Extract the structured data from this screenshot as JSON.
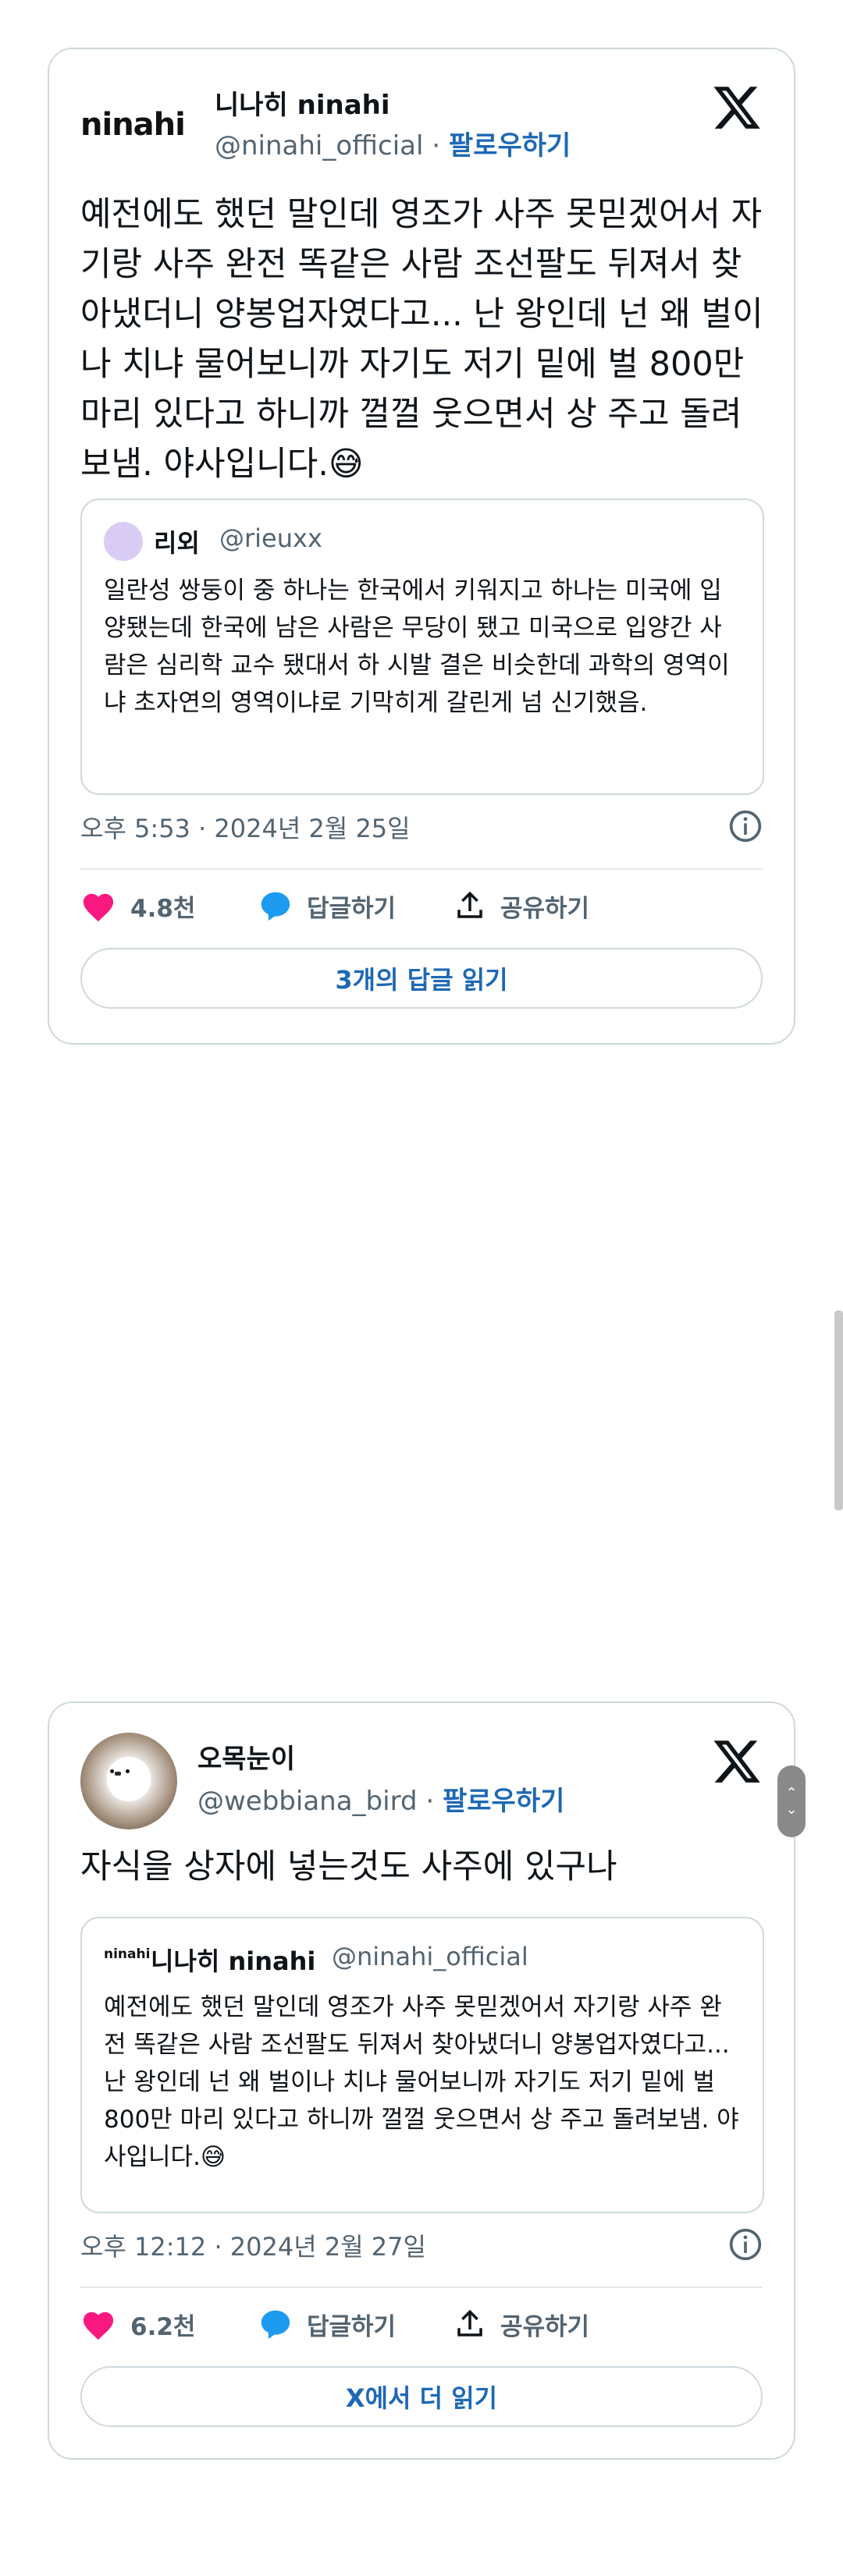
{
  "tweet1": {
    "logo_text": "ninahi",
    "name": "니나히 ninahi",
    "handle": "@ninahi_official",
    "separator": " · ",
    "follow_label": "팔로우하기",
    "text": "예전에도 했던 말인데 영조가 사주 못믿겠어서 자기랑 사주 완전 똑같은 사람 조선팔도 뒤져서 찾아냈더니 양봉업자였다고... 난 왕인데 넌 왜 벌이나 치냐 물어보니까 자기도 저기 밑에 벌 800만 마리 있다고 하니까 껄껄 웃으면서 상 주고 돌려보냄. 야사입니다.😅",
    "quote": {
      "name": "리외",
      "handle": "@rieuxx",
      "text": "일란성 쌍둥이 중 하나는 한국에서 키워지고 하나는 미국에 입양됐는데 한국에 남은 사람은 무당이 됐고 미국으로 입양간 사람은 심리학 교수 됐대서 하 시발 결은 비슷한데 과학의 영역이냐 초자연의 영역이냐로 기막히게 갈린게 넘 신기했음."
    },
    "timestamp": "오후 5:53 · 2024년 2월 25일",
    "likes": "4.8천",
    "reply_label": "답글하기",
    "share_label": "공유하기",
    "read_button": "3개의 답글 읽기"
  },
  "tweet2": {
    "name": "오목눈이",
    "handle": "@webbiana_bird",
    "separator": " · ",
    "follow_label": "팔로우하기",
    "text": "자식을 상자에 넣는것도 사주에 있구나",
    "quote": {
      "logo_text": "ninahi",
      "name": "니나히 ninahi",
      "handle": "@ninahi_official",
      "text": "예전에도 했던 말인데 영조가 사주 못믿겠어서 자기랑 사주 완전 똑같은 사람 조선팔도 뒤져서 찾아냈더니 양봉업자였다고... 난 왕인데 넌 왜 벌이나 치냐 물어보니까 자기도 저기 밑에 벌 800만 마리 있다고 하니까 껄껄 웃으면서 상 주고 돌려보냄. 야사입니다.😅"
    },
    "timestamp": "오후 12:12 · 2024년 2월 27일",
    "likes": "6.2천",
    "reply_label": "답글하기",
    "share_label": "공유하기",
    "read_button": "X에서 더 읽기"
  },
  "colors": {
    "heart": "#f91880",
    "reply": "#1d9bf0",
    "link": "#1d68b5",
    "border": "#cfd9de"
  },
  "icons": [
    "x-logo-icon",
    "heart-icon",
    "speech-bubble-icon",
    "share-icon",
    "info-icon"
  ]
}
